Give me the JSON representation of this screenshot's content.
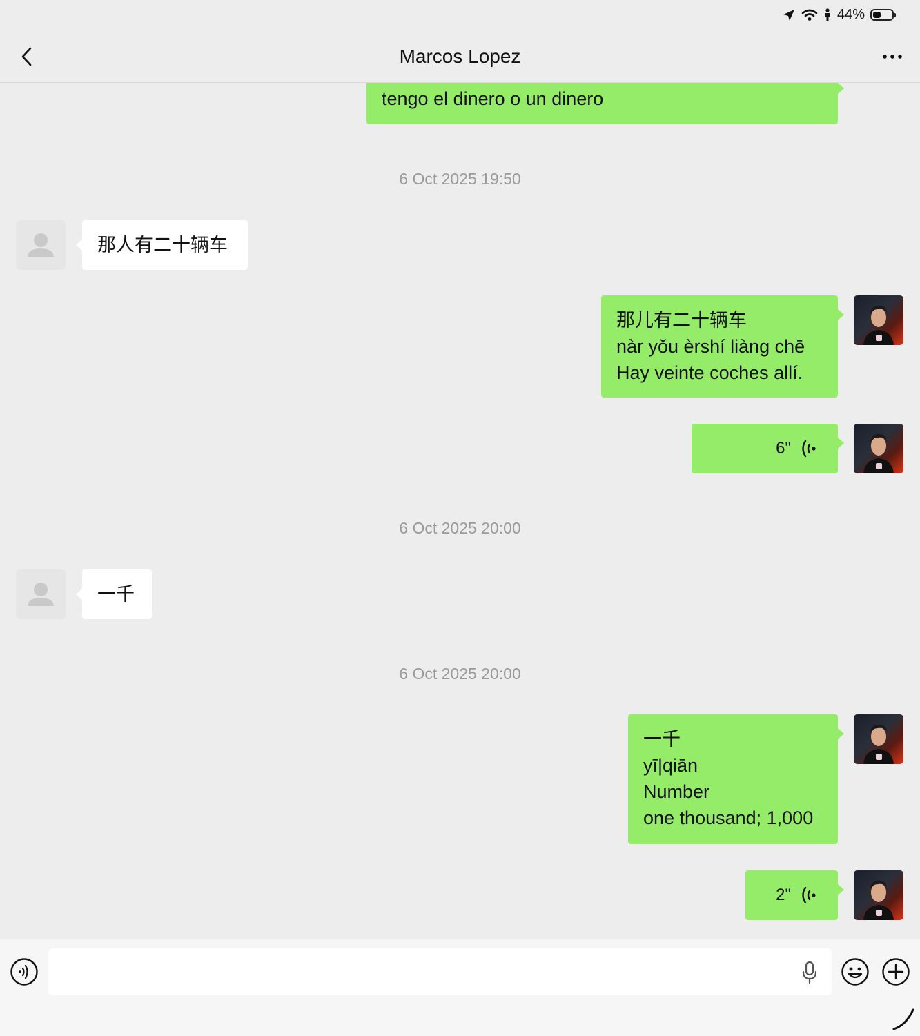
{
  "status_bar": {
    "battery_percent": "44%",
    "battery_level": 0.44
  },
  "nav": {
    "title": "Marcos Lopez"
  },
  "messages": {
    "m0": {
      "lines": [
        "tengo el dinero o un dinero"
      ]
    },
    "t1": "6 Oct 2025 19:50",
    "m1": {
      "text": "那人有二十辆车"
    },
    "m2": {
      "lines": [
        "那儿有二十辆车",
        "nàr yǒu èrshí liàng chē",
        "Hay veinte coches allí."
      ]
    },
    "v1": {
      "duration": "6\""
    },
    "t2": "6 Oct 2025 20:00",
    "m3": {
      "text": "一千"
    },
    "t3": "6 Oct 2025 20:00",
    "m4": {
      "lines": [
        "一千",
        "yī|qiān",
        "Number",
        "one thousand; 1,000"
      ]
    },
    "v2": {
      "duration": "2\""
    }
  },
  "input": {
    "placeholder": ""
  },
  "colors": {
    "outgoing_bubble": "#95ec69",
    "incoming_bubble": "#ffffff",
    "background": "#ededed"
  },
  "icons": [
    "back-chevron-icon",
    "more-dots-icon",
    "voice-mode-icon",
    "microphone-icon",
    "emoji-icon",
    "plus-icon",
    "location-arrow-icon",
    "wifi-icon",
    "person-icon",
    "battery-icon"
  ]
}
